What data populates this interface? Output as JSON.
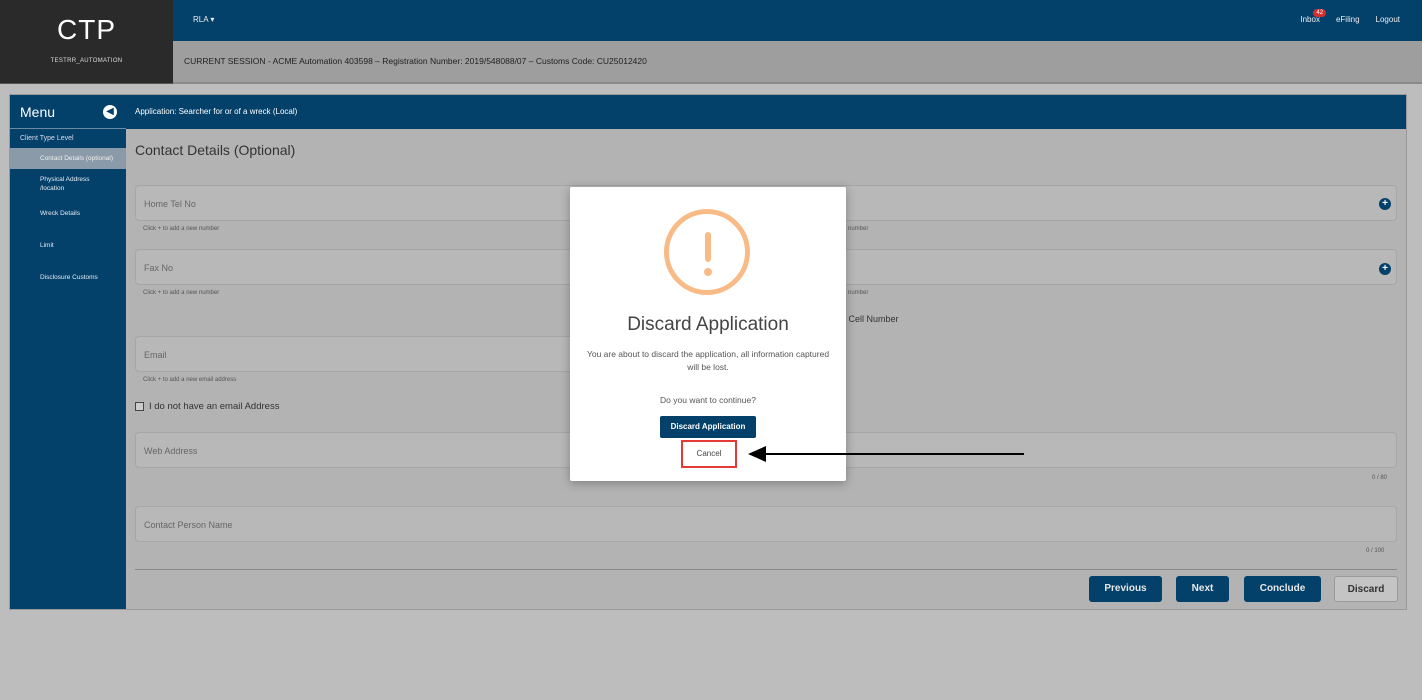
{
  "header": {
    "logo": "CTP",
    "user": "TESTRR_AUTOMATION",
    "menu_label": "RLA",
    "inbox_label": "Inbox",
    "inbox_count": "42",
    "efiling_label": "eFiling",
    "logout_label": "Logout",
    "session": "CURRENT SESSION - ACME Automation 403598 – Registration Number: 2019/548088/07 – Customs Code: CU25012420"
  },
  "sidebar": {
    "title": "Menu",
    "section": "Client Type Level",
    "items": [
      {
        "label": "Contact Details (optional)"
      },
      {
        "label": "Physical Address /location"
      },
      {
        "label": "Wreck Details"
      },
      {
        "label": "Limit"
      },
      {
        "label": "Disclosure Customs"
      }
    ]
  },
  "app_bar": {
    "title": "Application: Searcher for or of a wreck (Local)"
  },
  "form": {
    "title": "Contact Details (Optional)",
    "home_tel": "Home Tel No",
    "fax": "Fax No",
    "email": "Email",
    "web": "Web Address",
    "contact_person": "Contact Person Name",
    "hint_number": "Click + to add a new number",
    "hint_email": "Click + to add a new email address",
    "hint_number_right": "number",
    "hint_number_right2": "number",
    "cell_label": "a Cell Number",
    "no_email": "I do not have an email Address",
    "web_counter": "0 / 80",
    "contact_counter": "0 / 100"
  },
  "buttons": {
    "previous": "Previous",
    "next": "Next",
    "conclude": "Conclude",
    "discard": "Discard"
  },
  "modal": {
    "title": "Discard Application",
    "message": "You are about to discard the application, all information captured will be lost.",
    "question": "Do you want to continue?",
    "confirm": "Discard Application",
    "cancel": "Cancel"
  },
  "colors": {
    "primary": "#03406a",
    "warning": "#f8bb86",
    "highlight": "#e53935"
  }
}
